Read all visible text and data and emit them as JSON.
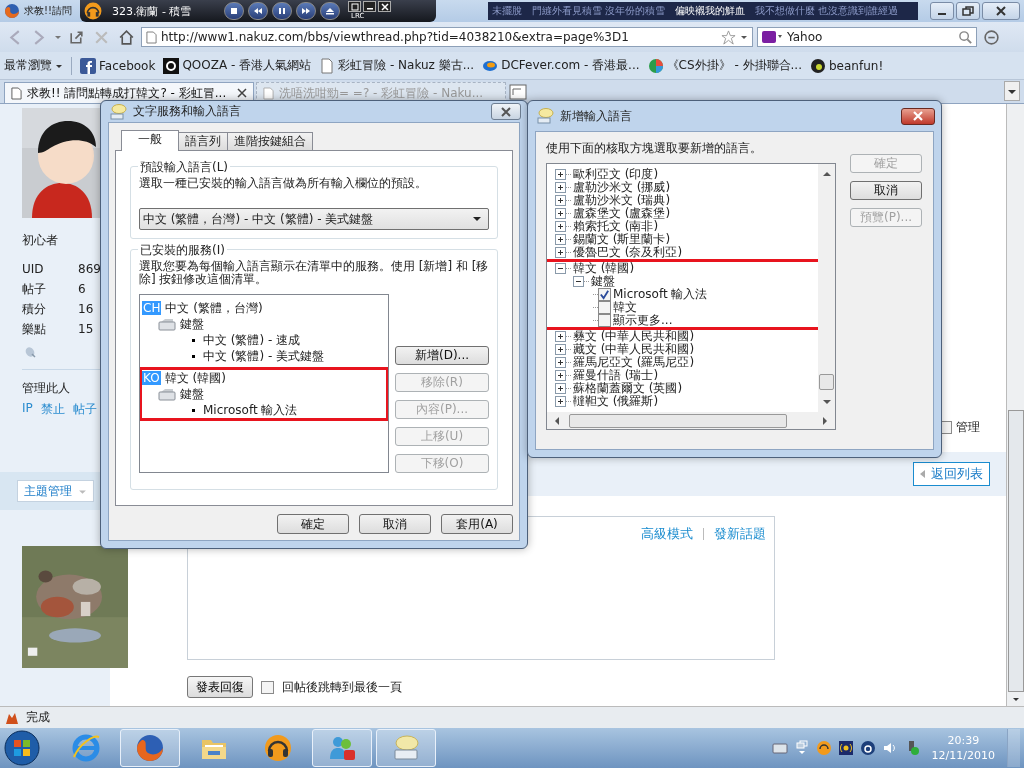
{
  "browser": {
    "title": "求教!!請問",
    "player": {
      "track": "323.衛蘭 - 積雪",
      "lrc": "LRC"
    },
    "lyrics": [
      {
        "text": "未擺脫",
        "current": false
      },
      {
        "text": "門縫外看見積雪 沒年份的積雪",
        "current": false
      },
      {
        "text": "偏映襯我的鮮血",
        "current": true
      },
      {
        "text": "我不想做什麼 也沒意識到誰經過",
        "current": false
      }
    ],
    "address": "http://www1.nakuz.com/bbs/viewthread.php?tid=4038210&extra=page%3D1",
    "search": {
      "value": "Yahoo"
    },
    "bookmarks": [
      {
        "label": "最常瀏覽",
        "kind": "menu"
      },
      {
        "label": "Facebook",
        "kind": "facebook"
      },
      {
        "label": "QOOZA - 香港人氣網站",
        "kind": "qooza"
      },
      {
        "label": "彩虹冒險 - Nakuz 樂古...",
        "kind": "page"
      },
      {
        "label": "DCFever.com - 香港最...",
        "kind": "dcfever"
      },
      {
        "label": "《CS外掛》 - 外掛聯合...",
        "kind": "cs"
      },
      {
        "label": "beanfun!",
        "kind": "beanfun"
      }
    ],
    "tabs": [
      {
        "label": "求教!! 請問點轉成打韓文? - 彩虹冒...",
        "selected": true
      },
      {
        "label": "洗唔洗咁勁= =? - 彩虹冒險 - Naku...",
        "selected": false
      }
    ],
    "status": "完成"
  },
  "sidebar": {
    "rank": "初心者",
    "stats": [
      {
        "label": "UID",
        "value": "869"
      },
      {
        "label": "帖子",
        "value": "6"
      },
      {
        "label": "積分",
        "value": "16"
      },
      {
        "label": "樂點",
        "value": "15"
      }
    ],
    "manage_title": "管理此人",
    "manage_links": [
      "IP",
      "禁止",
      "帖子"
    ],
    "topic_button": "主題管理"
  },
  "thread": {
    "manage": {
      "label": "管理",
      "checked": false
    },
    "back_button": "返回列表",
    "editor_links": [
      "高級模式",
      "發新話題"
    ],
    "reply_button": "發表回復",
    "jump_option": {
      "label": "回帖後跳轉到最後一頁",
      "checked": false
    }
  },
  "text_services_dialog": {
    "title": "文字服務和輸入語言",
    "tabs": [
      {
        "label": "一般",
        "selected": true
      },
      {
        "label": "語言列",
        "selected": false
      },
      {
        "label": "進階按鍵組合",
        "selected": false
      }
    ],
    "default_group": {
      "legend": "預設輸入語言(L)",
      "description": "選取一種已安裝的輸入語言做為所有輸入欄位的預設。",
      "value": "中文 (繁體，台灣) - 中文 (繁體) - 美式鍵盤"
    },
    "services_group": {
      "legend": "已安裝的服務(I)",
      "description": "選取您要為每個輸入語言顯示在清單中的服務。使用 [新增] 和 [移除] 按鈕修改這個清單。",
      "tree": [
        {
          "code": "CH",
          "label": "中文 (繁體，台灣)",
          "highlight": false,
          "children": [
            {
              "label": "鍵盤",
              "children": [
                {
                  "label": "中文 (繁體) - 速成"
                },
                {
                  "label": "中文 (繁體) - 美式鍵盤"
                }
              ]
            }
          ]
        },
        {
          "code": "KO",
          "label": "韓文 (韓國)",
          "highlight": true,
          "children": [
            {
              "label": "鍵盤",
              "children": [
                {
                  "label": "Microsoft 輸入法"
                }
              ]
            }
          ]
        }
      ],
      "buttons": [
        {
          "label": "新增(D)...",
          "disabled": false
        },
        {
          "label": "移除(R)",
          "disabled": true
        },
        {
          "label": "內容(P)...",
          "disabled": true
        },
        {
          "label": "上移(U)",
          "disabled": true
        },
        {
          "label": "下移(O)",
          "disabled": true
        }
      ]
    },
    "buttons": [
      {
        "label": "確定",
        "disabled": false
      },
      {
        "label": "取消",
        "disabled": false
      },
      {
        "label": "套用(A)",
        "disabled": false
      }
    ]
  },
  "add_language_dialog": {
    "title": "新增輸入語言",
    "instruction": "使用下面的核取方塊選取要新增的語言。",
    "tree": [
      {
        "label": "歐利亞文 (印度)",
        "expanded": false,
        "highlight": false
      },
      {
        "label": "盧勒沙米文 (挪威)",
        "expanded": false,
        "highlight": false
      },
      {
        "label": "盧勒沙米文 (瑞典)",
        "expanded": false,
        "highlight": false
      },
      {
        "label": "盧森堡文 (盧森堡)",
        "expanded": false,
        "highlight": false
      },
      {
        "label": "賴索托文 (南非)",
        "expanded": false,
        "highlight": false
      },
      {
        "label": "錫蘭文 (斯里蘭卡)",
        "expanded": false,
        "highlight": false
      },
      {
        "label": "優魯巴文 (奈及利亞)",
        "expanded": false,
        "highlight": false
      },
      {
        "label": "韓文 (韓國)",
        "expanded": true,
        "highlight": true,
        "children": [
          {
            "label": "鍵盤",
            "expanded": true,
            "children": [
              {
                "label": "Microsoft 輸入法",
                "checked": true
              },
              {
                "label": "韓文",
                "checked": false
              },
              {
                "label": "顯示更多...",
                "checked": false
              }
            ]
          }
        ]
      },
      {
        "label": "彝文 (中華人民共和國)",
        "expanded": false,
        "highlight": false
      },
      {
        "label": "藏文 (中華人民共和國)",
        "expanded": false,
        "highlight": false
      },
      {
        "label": "羅馬尼亞文 (羅馬尼亞)",
        "expanded": false,
        "highlight": false
      },
      {
        "label": "羅曼什語 (瑞士)",
        "expanded": false,
        "highlight": false
      },
      {
        "label": "蘇格蘭蓋爾文 (英國)",
        "expanded": false,
        "highlight": false
      },
      {
        "label": "韃靼文 (俄羅斯)",
        "expanded": false,
        "highlight": false
      }
    ],
    "buttons": [
      {
        "label": "確定",
        "disabled": true
      },
      {
        "label": "取消",
        "disabled": false
      },
      {
        "label": "預覽(P)...",
        "disabled": true
      }
    ]
  },
  "taskbar": {
    "apps": [
      {
        "kind": "ie",
        "active": false
      },
      {
        "kind": "firefox",
        "active": true
      },
      {
        "kind": "folder",
        "active": false
      },
      {
        "kind": "headphones",
        "active": false
      },
      {
        "kind": "messenger",
        "active": true
      },
      {
        "kind": "keyboard",
        "active": true
      }
    ],
    "time": "20:39",
    "date": "12/11/2010"
  }
}
